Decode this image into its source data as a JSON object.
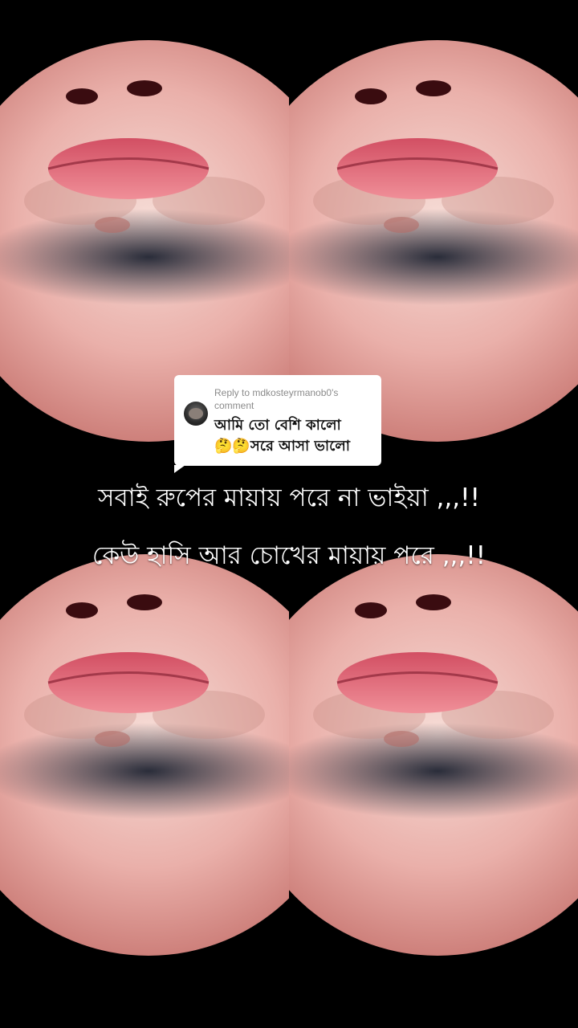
{
  "reply_card": {
    "reply_to": "Reply to mdkosteyrmanob0's comment",
    "comment_line_1": "আমি তো বেশি কালো",
    "comment_line_2": "🤔🤔সরে আসা ভালো"
  },
  "caption": {
    "line_1": "সবাই রুপের মায়ায় পরে না ভাইয়া ,,,!!",
    "line_2": "কেউ হাসি আর চোখের মায়ায় পরে ,,,!!"
  },
  "colors": {
    "background": "#000000",
    "skin": "#e9a6a1",
    "lips": "#e06a7a",
    "beard": "#2c3040"
  }
}
